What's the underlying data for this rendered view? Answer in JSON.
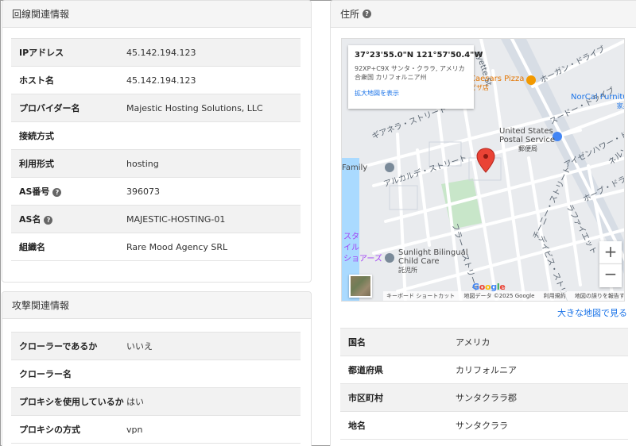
{
  "line_info": {
    "title": "回線関連情報",
    "rows": [
      {
        "key": "IPアドレス",
        "value": "45.142.194.123"
      },
      {
        "key": "ホスト名",
        "value": "45.142.194.123"
      },
      {
        "key": "プロバイダー名",
        "value": "Majestic Hosting Solutions, LLC"
      },
      {
        "key": "接続方式",
        "value": ""
      },
      {
        "key": "利用形式",
        "value": "hosting"
      },
      {
        "key": "AS番号",
        "value": "396073"
      },
      {
        "key": "AS名",
        "value": "MAJESTIC-HOSTING-01"
      },
      {
        "key": "組織名",
        "value": "Rare Mood Agency SRL"
      }
    ]
  },
  "attack_info": {
    "title": "攻撃関連情報",
    "rows": [
      {
        "key": "クローラーであるか",
        "value": "いいえ"
      },
      {
        "key": "クローラー名",
        "value": ""
      },
      {
        "key": "プロキシを使用しているか",
        "value": "はい"
      },
      {
        "key": "プロキシの方式",
        "value": "vpn"
      }
    ]
  },
  "address": {
    "title": "住所",
    "map": {
      "coord": "37°23'55.0\"N 121°57'50.4\"W",
      "addr": "92XP+C9X サンタ・クララ, アメリカ合衆国 カリフォルニア州",
      "enlarge": "拡大地図を表示",
      "zoom_in": "+",
      "zoom_out": "−",
      "google": "Google",
      "attrib_shortcuts": "キーボード ショートカット",
      "attrib_data": "地図データ ©2025 Google",
      "attrib_terms": "利用規約",
      "attrib_report": "地図の誤りを報告する",
      "labels": {
        "caesars": "Caesars Pizza",
        "caesars_jp": "ピザ店",
        "norcal": "NorCal Furniture",
        "norcal_jp": "家具店",
        "usps1": "United States",
        "usps2": "Postal Service",
        "usps_jp": "郵便局",
        "sunlight1": "Sunlight Bilingual",
        "sunlight2": "Child Care",
        "sunlight_jp": "託児所",
        "family": "Family",
        "lafayette": "ayette St",
        "hogan": "ホーガン・ドライブ",
        "sueed": "スードー・ドライブ",
        "eisenhower": "アイゼンハワー・ドライブ",
        "neru": "ネルソ",
        "hope": "ホープ・ドライブ",
        "lafayette_jp": "ラファイエット",
        "gianera": "ギアネラ・ストリート",
        "alcalde": "アルカルデ・ストリート",
        "flora": "フラー・ストリート",
        "chenery": "チーニー・ストリート",
        "davis": "デイビス・ストリート",
        "star": "スタ",
        "yi": "イル",
        "jo": "ショアーズ"
      }
    },
    "map_link": "大きな地図で見る",
    "rows": [
      {
        "key": "国名",
        "value": "アメリカ"
      },
      {
        "key": "都道府県",
        "value": "カリフォルニア"
      },
      {
        "key": "市区町村",
        "value": "サンタクララ郡"
      },
      {
        "key": "地名",
        "value": "サンタクララ"
      }
    ]
  },
  "colors": {
    "link": "#1a73e8",
    "pin": "#ea4335",
    "park": "#c8e6c9",
    "water": "#aadaff",
    "road": "#ffffff",
    "highway": "#d7dde5"
  }
}
